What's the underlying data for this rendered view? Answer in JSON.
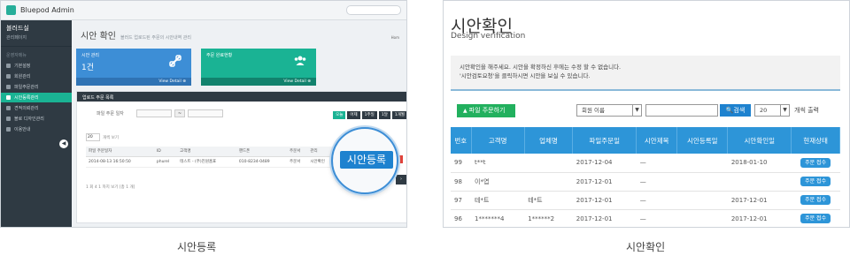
{
  "left": {
    "titlebar": {
      "title": "Bluepod Admin"
    },
    "sidebar": {
      "brand": "블러드실",
      "brand_sub": "관리페이지",
      "section": "운영자메뉴",
      "items": [
        {
          "label": "기본설정",
          "active": false
        },
        {
          "label": "회원관리",
          "active": false
        },
        {
          "label": "파일주문관리",
          "active": false
        },
        {
          "label": "시안등록관리",
          "active": true
        },
        {
          "label": "견적의뢰관리",
          "active": false
        },
        {
          "label": "블로 디자인관리",
          "active": false
        },
        {
          "label": "이용안내",
          "active": false
        }
      ],
      "collapse_glyph": "◀"
    },
    "page": {
      "title": "시안 확인",
      "subtitle": "블러드 업로드된 주문의 시안내역 관리",
      "right": "Hom"
    },
    "cards": [
      {
        "label": "시안 관리",
        "value": "1건",
        "footer": "View Detail ⊕",
        "icon": "link-icon"
      },
      {
        "label": "주문 완료현황",
        "value": "",
        "footer": "View Detail ⊕",
        "icon": "users-icon"
      }
    ],
    "panel": {
      "head": "업로드 주문 목록",
      "filter_label": "파일 주문 일자",
      "filter_sep": "~",
      "periods": [
        "오늘",
        "어제",
        "1주일",
        "1달",
        "1개월"
      ],
      "perpage_value": "20",
      "perpage_label": "개씩 보기",
      "columns": [
        "파일 주문일자",
        "ID",
        "고객명",
        "핸드폰",
        "주문서",
        "관리"
      ],
      "rows": [
        {
          "date": "2014-08-13 16:50:50",
          "id": "phurel",
          "name": "테스트 - (주)진원홈표",
          "phone": "010-8234-0489",
          "order": "주문서",
          "manage": "시안확인"
        }
      ],
      "footer": "1 회 4 1 까지 보기 [총 1 개]",
      "next": "›"
    },
    "magnifier_button": "시안등록",
    "caption": "시안등록"
  },
  "right": {
    "title": "시안확인",
    "subtitle": "Design verification",
    "notice_lines": [
      "시안확인을 해주세요. 시안을 확정하신 후에는 수정 할 수 없습니다.",
      "'시안검토요청'을 클릭하시면 시안을 보실 수 있습니다."
    ],
    "upload_button": "파일 주문하기",
    "name_select": "회원 이름",
    "search_button": "검색",
    "count_select": "20",
    "count_label": "개씩 출력",
    "columns": [
      "번호",
      "고객명",
      "업체명",
      "파일주문일",
      "시안제목",
      "시안등록일",
      "시안확인일",
      "현재상태"
    ],
    "rows": [
      {
        "no": "99",
        "name": "t**t",
        "company": "",
        "order_date": "2017-12-04",
        "design_title": "—",
        "reg_date": "",
        "confirm_date": "2018-01-10",
        "status": "주문 접수"
      },
      {
        "no": "98",
        "name": "이*엽",
        "company": "",
        "order_date": "2017-12-01",
        "design_title": "—",
        "reg_date": "",
        "confirm_date": "",
        "status": "주문 접수"
      },
      {
        "no": "97",
        "name": "테*트",
        "company": "테*트",
        "order_date": "2017-12-01",
        "design_title": "—",
        "reg_date": "",
        "confirm_date": "2017-12-01",
        "status": "주문 접수"
      },
      {
        "no": "96",
        "name": "1*******4",
        "company": "1******2",
        "order_date": "2017-12-01",
        "design_title": "—",
        "reg_date": "",
        "confirm_date": "2017-12-01",
        "status": "주문 접수"
      }
    ],
    "caption": "시안확인"
  },
  "colors": {
    "accent_blue": "#2d95d8",
    "accent_green": "#1ab394",
    "sidebar_dark": "#2f3a43",
    "upload_green": "#22b05e"
  }
}
